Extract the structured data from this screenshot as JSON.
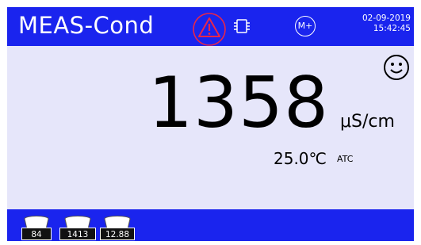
{
  "header": {
    "title": "MEAS-Cond",
    "date": "02-09-2019",
    "time": "15:42:45",
    "mplus_label": "M+",
    "icons": [
      "warning-icon",
      "chip-icon",
      "memory-plus-icon"
    ]
  },
  "measurement": {
    "value": "1358",
    "unit": "μS/cm",
    "temperature": "25.0℃",
    "temp_mode": "ATC",
    "status_icon": "smiley-icon"
  },
  "calibration": {
    "standards": [
      "84",
      "1413",
      "12.88"
    ]
  },
  "colors": {
    "bar": "#1a24ee",
    "screen": "#e6e6fa",
    "warning": "#e8264a"
  }
}
